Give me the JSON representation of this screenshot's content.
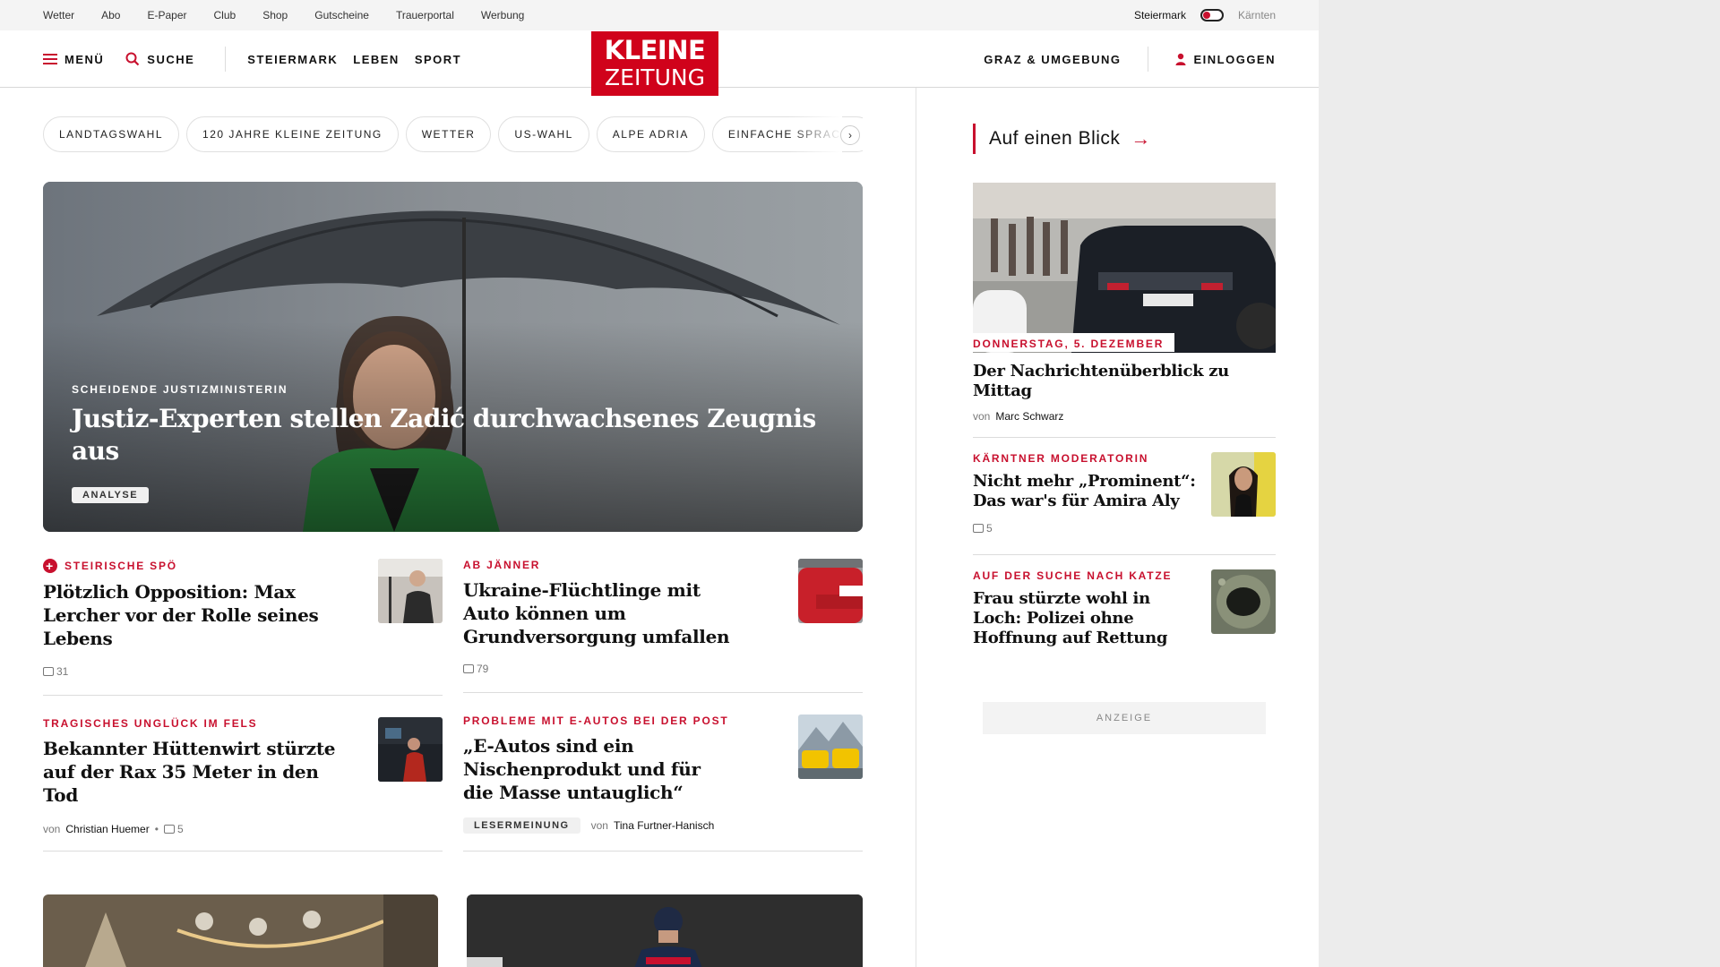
{
  "topbar": {
    "links": [
      "Wetter",
      "Abo",
      "E-Paper",
      "Club",
      "Shop",
      "Gutscheine",
      "Trauerportal",
      "Werbung"
    ],
    "region_active": "Steiermark",
    "region_inactive": "Kärnten"
  },
  "header": {
    "menu_label": "MENÜ",
    "search_label": "SUCHE",
    "sections": [
      "STEIERMARK",
      "LEBEN",
      "SPORT"
    ],
    "logo_line1": "KLEINE",
    "logo_line2": "ZEITUNG",
    "local_label": "GRAZ & UMGEBUNG",
    "login_label": "EINLOGGEN"
  },
  "chips": [
    "LANDTAGSWAHL",
    "120 JAHRE KLEINE ZEITUNG",
    "WETTER",
    "US-WAHL",
    "ALPE ADRIA",
    "EINFACHE SPRACHE"
  ],
  "hero": {
    "kicker": "SCHEIDENDE JUSTIZMINISTERIN",
    "title": "Justiz-Experten stellen Zadić durchwachsenes Zeugnis aus",
    "badge": "ANALYSE"
  },
  "articles": [
    {
      "kicker": "STEIRISCHE SPÖ",
      "title": "Plötzlich Opposition: Max Lercher vor der Rolle seines Lebens",
      "comments": "31"
    },
    {
      "kicker": "AB JÄNNER",
      "title": "Ukraine-Flüchtlinge mit Auto können um Grundversorgung umfallen",
      "comments": "79"
    },
    {
      "kicker": "TRAGISCHES UNGLÜCK IM FELS",
      "title": "Bekannter Hüttenwirt stürzte auf der Rax 35 Meter in den Tod",
      "by": "von",
      "author": "Christian Huemer",
      "comments": "5"
    },
    {
      "kicker": "PROBLEME MIT E-AUTOS BEI DER POST",
      "title": "„E-Autos sind ein Nischenprodukt und für die Masse untauglich“",
      "badge": "LESERMEINUNG",
      "by": "von",
      "author": "Tina Furtner-Hanisch"
    }
  ],
  "sidebar": {
    "heading": "Auf einen Blick",
    "feature": {
      "kicker": "DONNERSTAG, 5. DEZEMBER",
      "title": "Der Nachrichtenüberblick zu Mittag",
      "by": "von",
      "author": "Marc Schwarz"
    },
    "items": [
      {
        "kicker": "KÄRNTNER MODERATORIN",
        "title": "Nicht mehr „Prominent“: Das war's für Amira Aly",
        "comments": "5"
      },
      {
        "kicker": "AUF DER SUCHE NACH KATZE",
        "title": "Frau stürzte wohl in Loch: Polizei ohne Hoffnung auf Rettung"
      }
    ]
  },
  "ad_label": "ANZEIGE",
  "colors": {
    "brand_red": "#d0021b",
    "accent_red": "#c8102e"
  }
}
